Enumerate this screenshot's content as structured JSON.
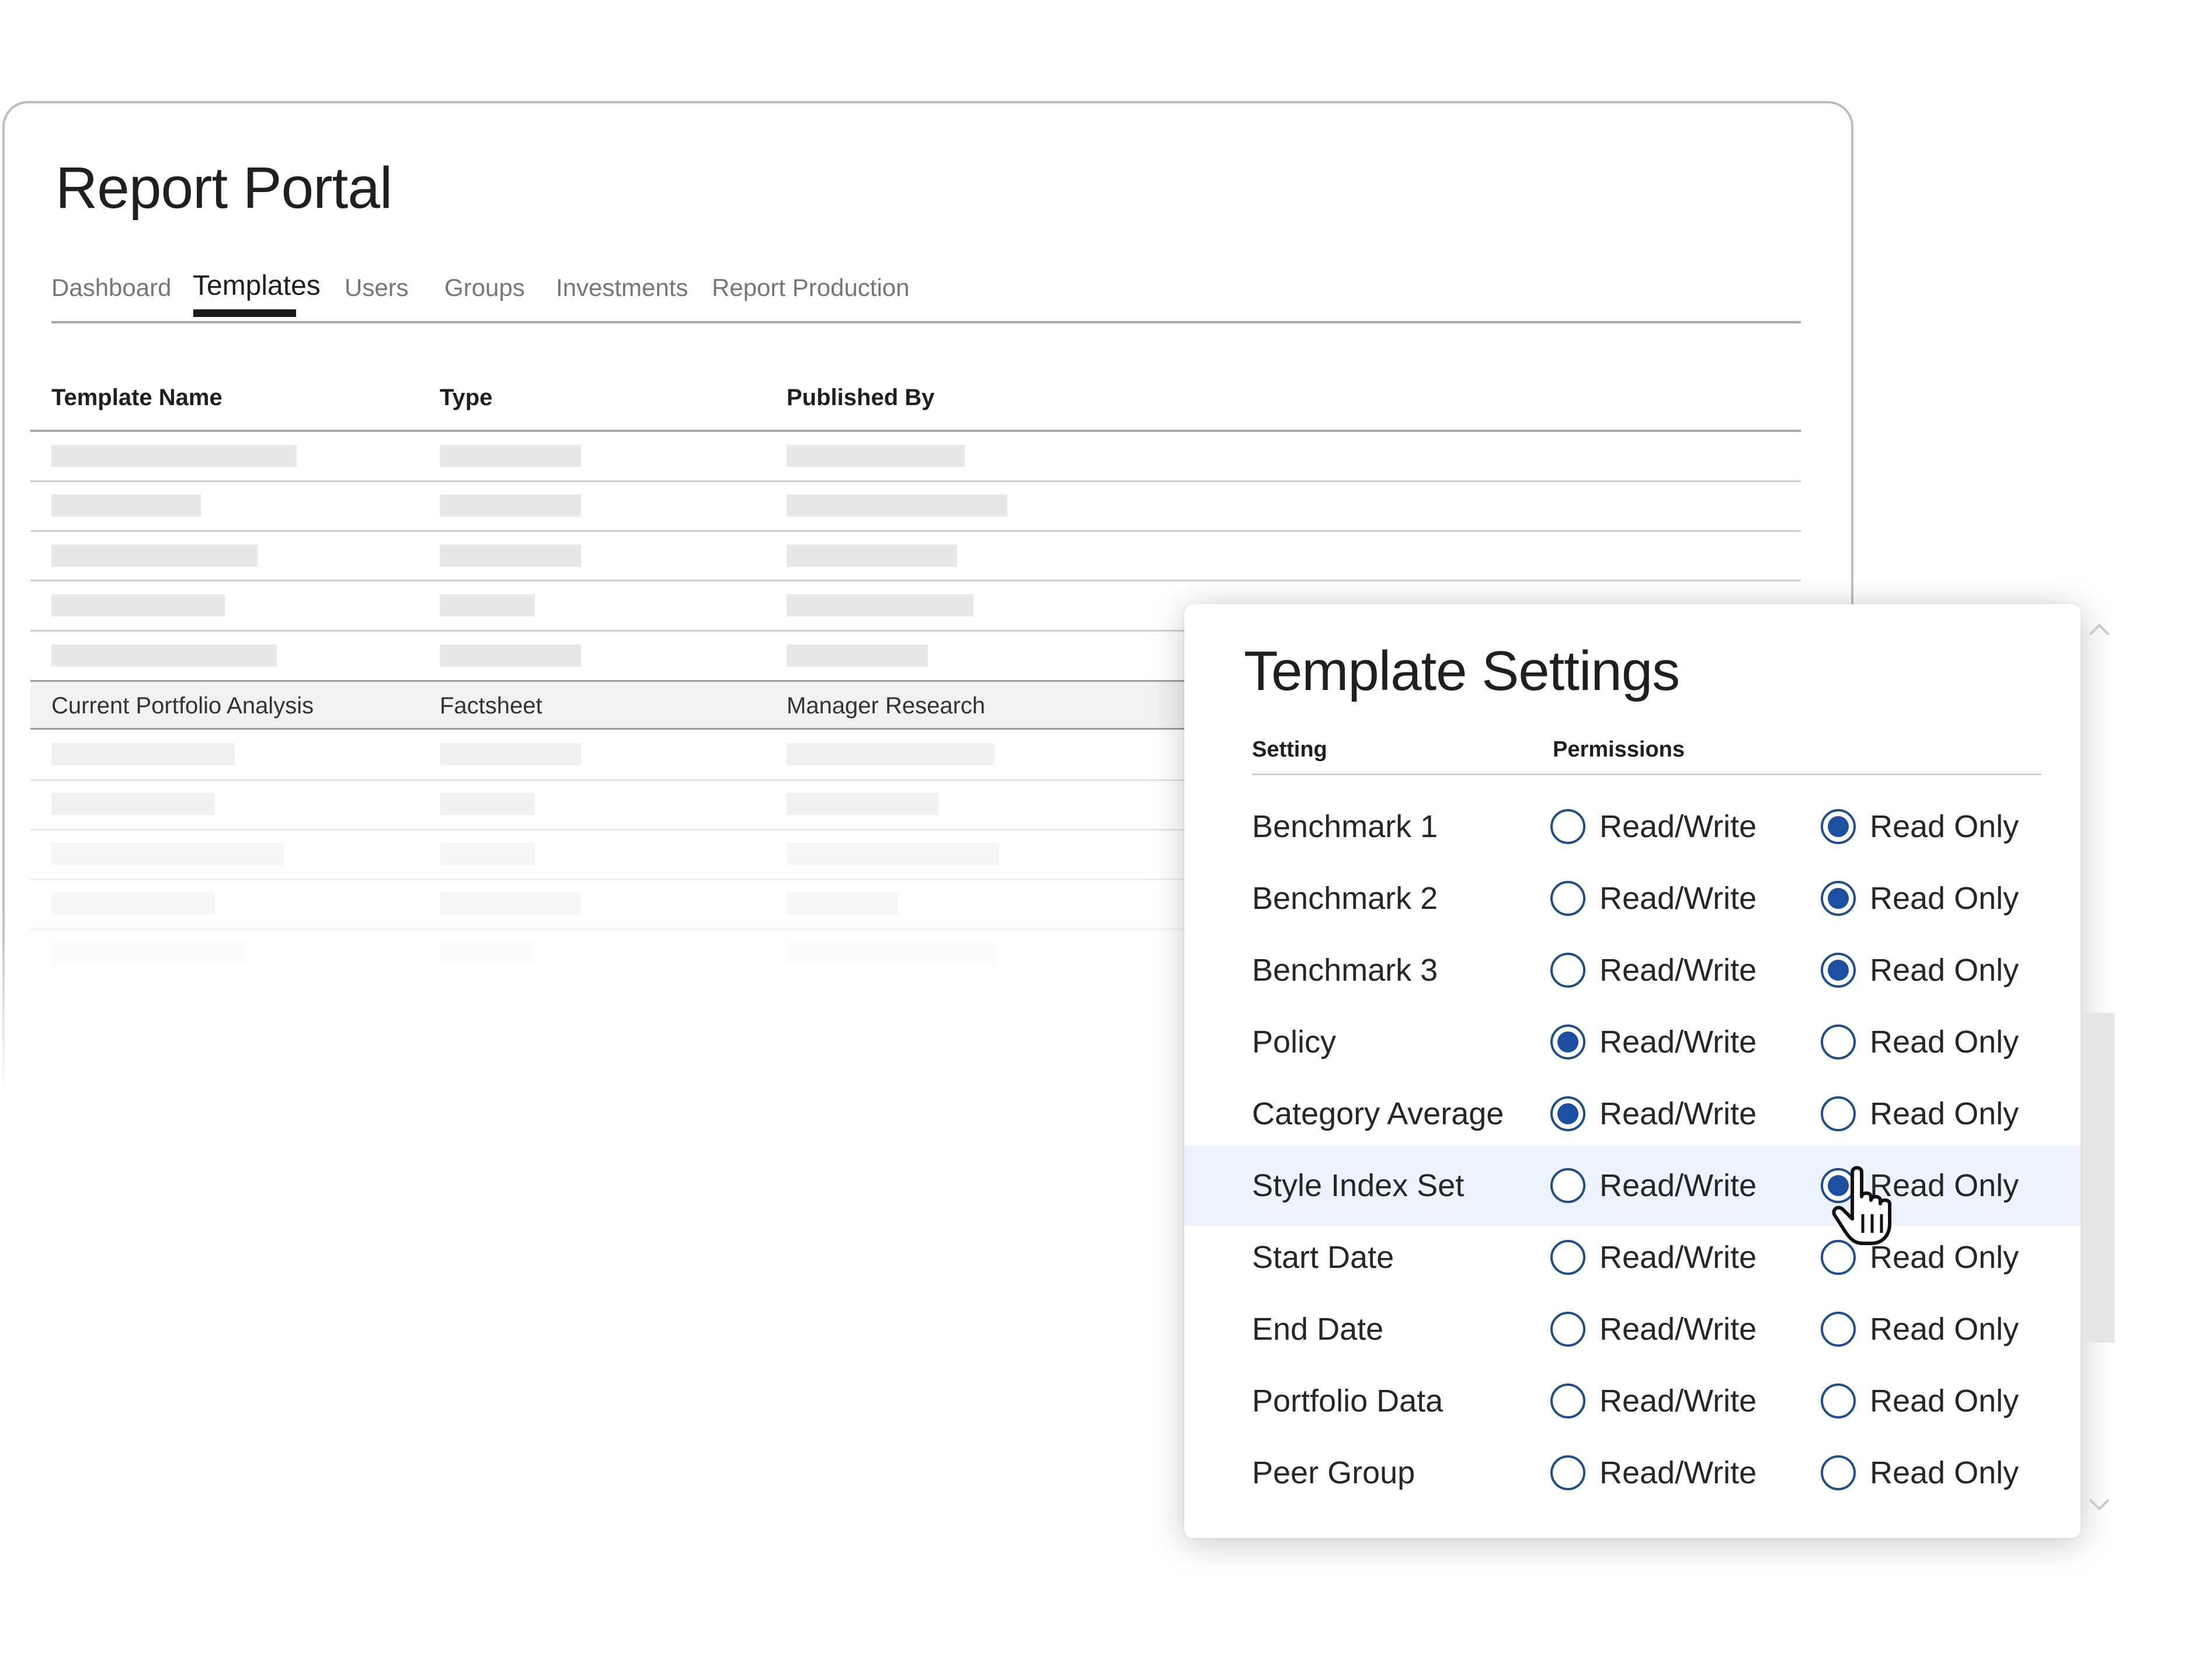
{
  "app": {
    "title": "Report Portal",
    "tabs": [
      {
        "label": "Dashboard",
        "active": false
      },
      {
        "label": "Templates",
        "active": true
      },
      {
        "label": "Users",
        "active": false
      },
      {
        "label": "Groups",
        "active": false
      },
      {
        "label": "Investments",
        "active": false
      },
      {
        "label": "Report Production",
        "active": false
      }
    ]
  },
  "table": {
    "columns": [
      "Template Name",
      "Type",
      "Published By"
    ],
    "selected_row": {
      "name": "Current Portfolio Analysis",
      "type": "Factsheet",
      "published_by": "Manager Research"
    }
  },
  "dialog": {
    "title": "Template Settings",
    "columns": {
      "setting": "Setting",
      "permissions": "Permissions"
    },
    "options": {
      "rw": "Read/Write",
      "ro": "Read Only"
    },
    "rows": [
      {
        "label": "Benchmark 1",
        "value": "ro"
      },
      {
        "label": "Benchmark 2",
        "value": "ro"
      },
      {
        "label": "Benchmark 3",
        "value": "ro"
      },
      {
        "label": "Policy",
        "value": "rw"
      },
      {
        "label": "Category Average",
        "value": "rw"
      },
      {
        "label": "Style Index Set",
        "value": "ro",
        "highlighted": true
      },
      {
        "label": "Start Date",
        "value": ""
      },
      {
        "label": "End Date",
        "value": ""
      },
      {
        "label": "Portfolio Data",
        "value": ""
      },
      {
        "label": "Peer Group",
        "value": ""
      }
    ]
  },
  "colors": {
    "accent": "#1d4fa0",
    "row_highlight": "#eef3fb",
    "placeholder": "#e8e8e8"
  },
  "icons": {
    "cursor": "hand-pointer-icon",
    "scroll_up": "chevron-up-icon",
    "scroll_down": "chevron-down-icon"
  }
}
